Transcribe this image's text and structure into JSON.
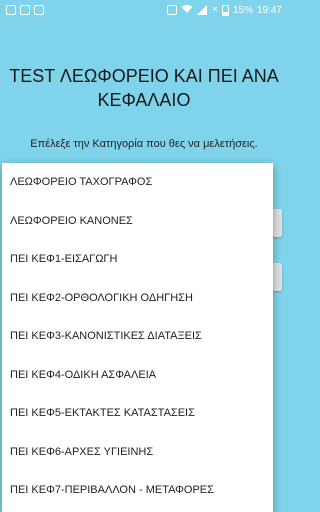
{
  "status_bar": {
    "left_icons": [
      "image-icon",
      "lock-icon",
      "sim-icon"
    ],
    "battery_percent": "15%",
    "time": "19:47"
  },
  "header": {
    "title": "TEST ΛΕΩΦΟΡΕΙΟ ΚΑΙ ΠΕΙ ΑΝΑ ΚΕΦΑΛΑΙΟ",
    "subtitle": "Επέλεξε την Κατηγορία που θες να μελετήσεις."
  },
  "dropdown": {
    "items": [
      "ΛΕΩΦΟΡΕΙΟ ΤΑΧΟΓΡΑΦΟΣ",
      "ΛΕΩΦΟΡΕΙΟ ΚΑΝΟΝΕΣ",
      "ΠΕΙ ΚΕΦ1-ΕΙΣΑΓΩΓΗ",
      "ΠΕΙ ΚΕΦ2-ΟΡΘΟΛΟΓΙΚΗ ΟΔΗΓΗΣΗ",
      "ΠΕΙ ΚΕΦ3-ΚΑΝΟΝΙΣΤΙΚΕΣ ΔΙΑΤΑΞΕΙΣ",
      "ΠΕΙ ΚΕΦ4-ΟΔΙΚΗ ΑΣΦΑΛΕΙΑ",
      "ΠΕΙ ΚΕΦ5-ΕΚΤΑΚΤΕΣ ΚΑΤΑΣΤΑΣΕΙΣ",
      "ΠΕΙ ΚΕΦ6-ΑΡΧΕΣ ΥΓΙΕΙΝΗΣ",
      "ΠΕΙ ΚΕΦ7-ΠΕΡΙΒΑΛΛΟΝ - ΜΕΤΑΦΟΡΕΣ"
    ]
  },
  "colors": {
    "background": "#7fd3ea",
    "dropdown_bg": "#ffffff",
    "text": "#222222"
  }
}
